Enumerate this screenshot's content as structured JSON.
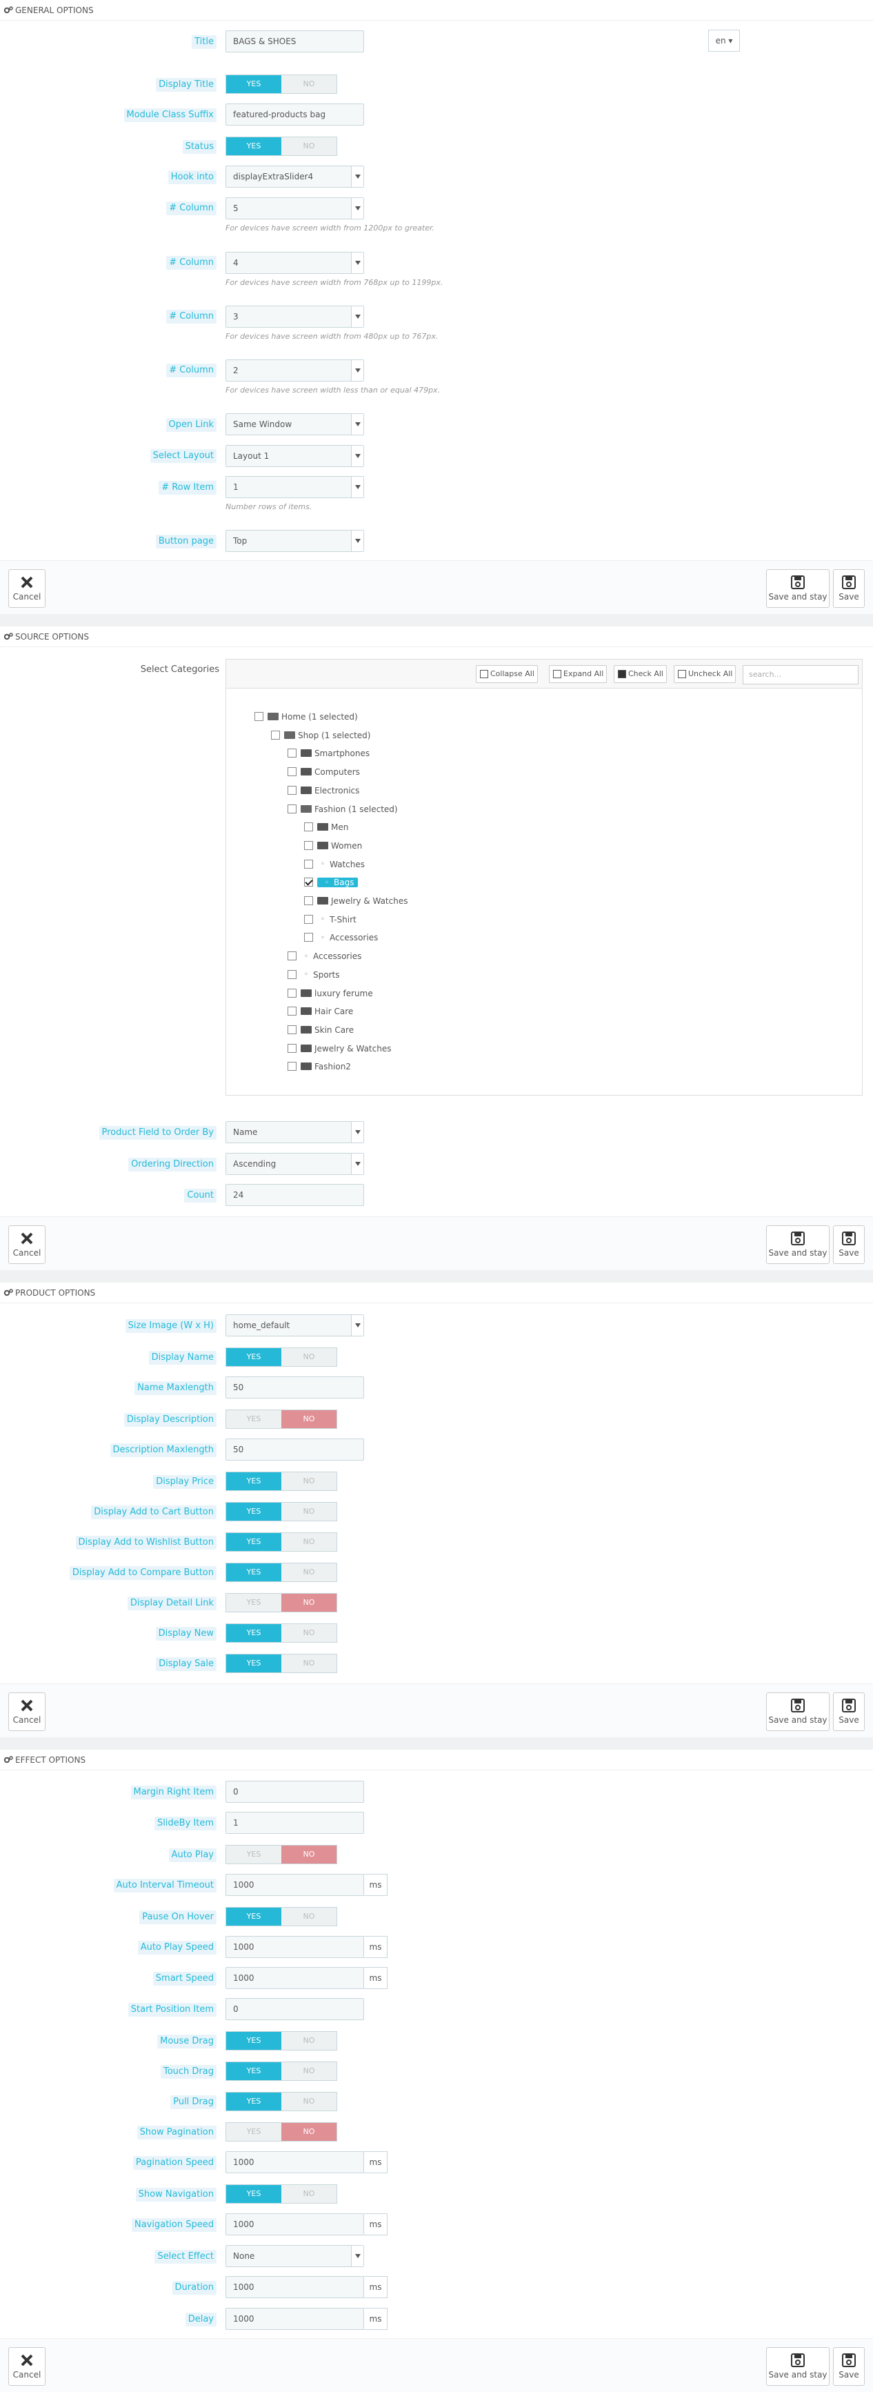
{
  "sections": {
    "general": "GENERAL OPTIONS",
    "source": "SOURCE OPTIONS",
    "product": "PRODUCT OPTIONS",
    "effect": "EFFECT OPTIONS"
  },
  "general": {
    "title_label": "Title",
    "title_value": "BAGS & SHOES",
    "lang": "en",
    "display_title_label": "Display Title",
    "module_class_label": "Module Class Suffix",
    "module_class_value": "featured-products bag",
    "status_label": "Status",
    "hook_label": "Hook into",
    "hook_value": "displayExtraSlider4",
    "col1_label": "# Column",
    "col1_value": "5",
    "col1_help": "For devices have screen width from 1200px to greater.",
    "col2_label": "# Column",
    "col2_value": "4",
    "col2_help": "For devices have screen width from 768px up to 1199px.",
    "col3_label": "# Column",
    "col3_value": "3",
    "col3_help": "For devices have screen width from 480px up to 767px.",
    "col4_label": "# Column",
    "col4_value": "2",
    "col4_help": "For devices have screen width less than or equal 479px.",
    "open_link_label": "Open Link",
    "open_link_value": "Same Window",
    "layout_label": "Select Layout",
    "layout_value": "Layout 1",
    "row_item_label": "# Row Item",
    "row_item_value": "1",
    "row_item_help": "Number rows of items.",
    "button_page_label": "Button page",
    "button_page_value": "Top"
  },
  "toggle": {
    "yes": "YES",
    "no": "NO"
  },
  "footer": {
    "cancel": "Cancel",
    "save_stay": "Save and stay",
    "save": "Save"
  },
  "source": {
    "select_categories_label": "Select Categories",
    "collapse_all": "Collapse All",
    "expand_all": "Expand All",
    "check_all": "Check All",
    "uncheck_all": "Uncheck All",
    "search_placeholder": "search...",
    "tree": [
      {
        "label": "Home (1 selected)",
        "depth": 0,
        "kind": "folder-open",
        "checked": false
      },
      {
        "label": "Shop (1 selected)",
        "depth": 1,
        "kind": "folder-open",
        "checked": false
      },
      {
        "label": "Smartphones",
        "depth": 2,
        "kind": "folder",
        "checked": false
      },
      {
        "label": "Computers",
        "depth": 2,
        "kind": "folder",
        "checked": false
      },
      {
        "label": "Electronics",
        "depth": 2,
        "kind": "folder",
        "checked": false
      },
      {
        "label": "Fashion (1 selected)",
        "depth": 2,
        "kind": "folder-open",
        "checked": false
      },
      {
        "label": "Men",
        "depth": 3,
        "kind": "folder",
        "checked": false
      },
      {
        "label": "Women",
        "depth": 3,
        "kind": "folder",
        "checked": false
      },
      {
        "label": "Watches",
        "depth": 3,
        "kind": "leaf",
        "checked": false
      },
      {
        "label": "Bags",
        "depth": 3,
        "kind": "leaf",
        "checked": true
      },
      {
        "label": "Jewelry & Watches",
        "depth": 3,
        "kind": "folder",
        "checked": false
      },
      {
        "label": "T-Shirt",
        "depth": 3,
        "kind": "leaf",
        "checked": false
      },
      {
        "label": "Accessories",
        "depth": 3,
        "kind": "leaf",
        "checked": false
      },
      {
        "label": "Accessories",
        "depth": 2,
        "kind": "leaf",
        "checked": false
      },
      {
        "label": "Sports",
        "depth": 2,
        "kind": "leaf",
        "checked": false
      },
      {
        "label": "luxury ferume",
        "depth": 2,
        "kind": "folder",
        "checked": false
      },
      {
        "label": "Hair Care",
        "depth": 2,
        "kind": "folder",
        "checked": false
      },
      {
        "label": "Skin Care",
        "depth": 2,
        "kind": "folder",
        "checked": false
      },
      {
        "label": "Jewelry & Watches",
        "depth": 2,
        "kind": "folder",
        "checked": false
      },
      {
        "label": "Fashion2",
        "depth": 2,
        "kind": "folder",
        "checked": false
      }
    ],
    "order_by_label": "Product Field to Order By",
    "order_by_value": "Name",
    "order_dir_label": "Ordering Direction",
    "order_dir_value": "Ascending",
    "count_label": "Count",
    "count_value": "24"
  },
  "product": {
    "size_image_label": "Size Image (W x H)",
    "size_image_value": "home_default",
    "display_name_label": "Display Name",
    "name_maxlength_label": "Name Maxlength",
    "name_maxlength_value": "50",
    "display_desc_label": "Display Description",
    "desc_maxlength_label": "Description Maxlength",
    "desc_maxlength_value": "50",
    "display_price_label": "Display Price",
    "add_cart_label": "Display Add to Cart Button",
    "add_wishlist_label": "Display Add to Wishlist Button",
    "add_compare_label": "Display Add to Compare Button",
    "detail_link_label": "Display Detail Link",
    "display_new_label": "Display New",
    "display_sale_label": "Display Sale"
  },
  "effect": {
    "margin_right_label": "Margin Right Item",
    "margin_right_value": "0",
    "slideby_label": "SlideBy Item",
    "slideby_value": "1",
    "autoplay_label": "Auto Play",
    "auto_interval_label": "Auto Interval Timeout",
    "auto_interval_value": "1000",
    "pause_hover_label": "Pause On Hover",
    "autoplay_speed_label": "Auto Play Speed",
    "autoplay_speed_value": "1000",
    "smart_speed_label": "Smart Speed",
    "smart_speed_value": "1000",
    "start_pos_label": "Start Position Item",
    "start_pos_value": "0",
    "mouse_drag_label": "Mouse Drag",
    "touch_drag_label": "Touch Drag",
    "pull_drag_label": "Pull Drag",
    "show_pagination_label": "Show Pagination",
    "pagination_speed_label": "Pagination Speed",
    "pagination_speed_value": "1000",
    "show_nav_label": "Show Navigation",
    "nav_speed_label": "Navigation Speed",
    "nav_speed_value": "1000",
    "select_effect_label": "Select Effect",
    "select_effect_value": "None",
    "duration_label": "Duration",
    "duration_value": "1000",
    "delay_label": "Delay",
    "delay_value": "1000",
    "unit": "ms"
  },
  "colors": {
    "accent": "#25b9d7",
    "off": "#e08f95"
  }
}
